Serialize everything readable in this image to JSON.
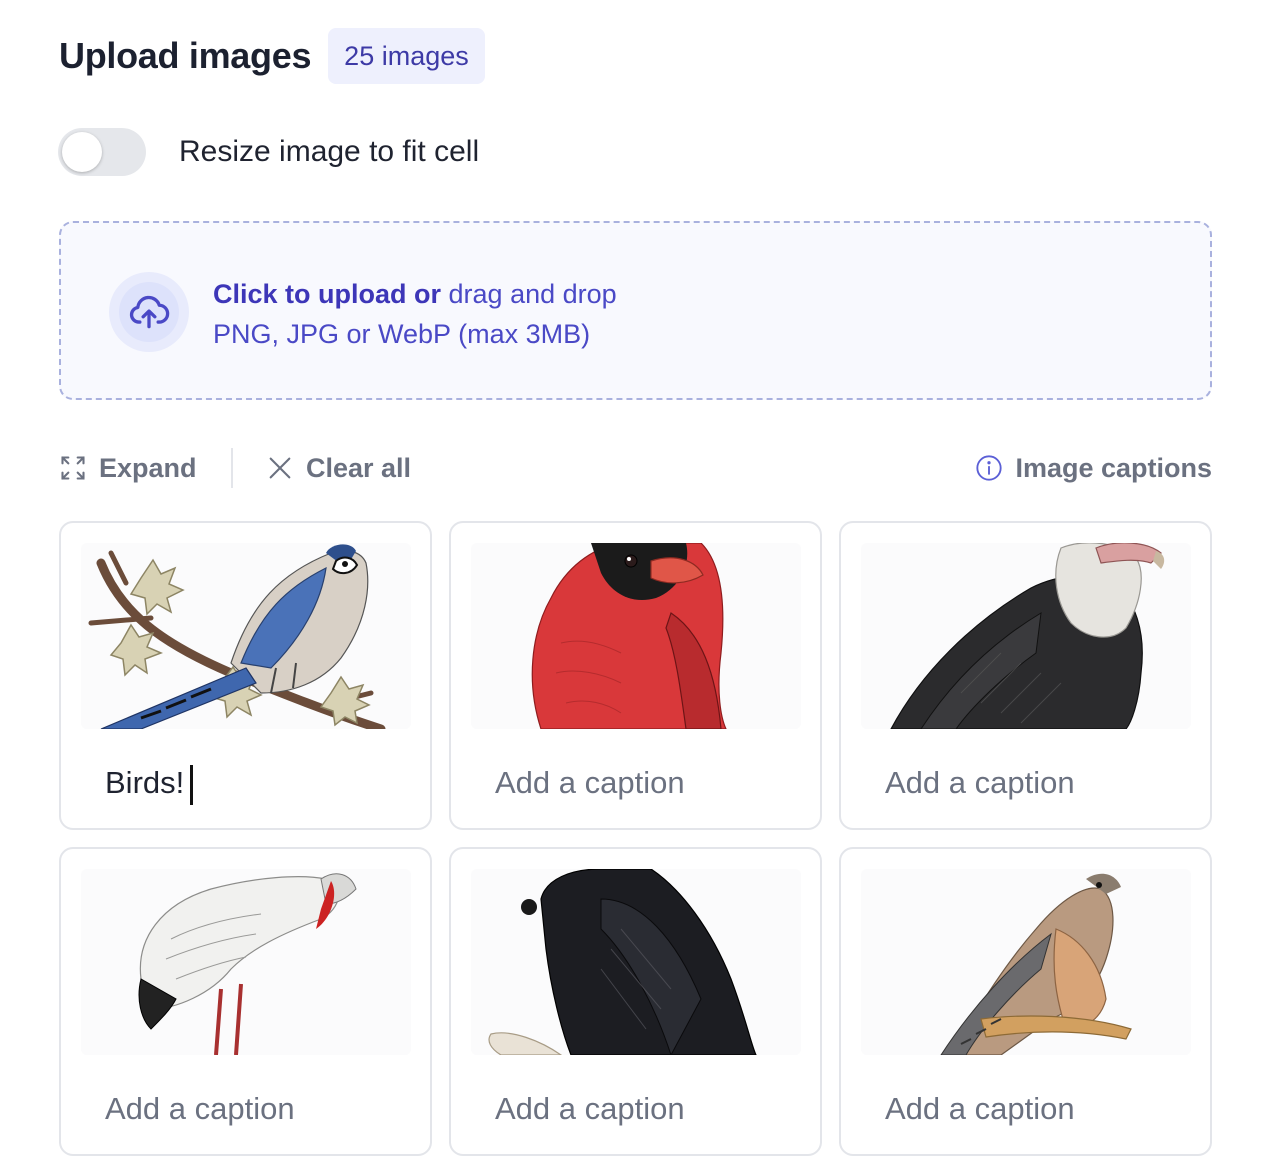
{
  "header": {
    "title": "Upload images",
    "badge": "25 images"
  },
  "resize_toggle": {
    "label": "Resize image to fit cell",
    "checked": false
  },
  "dropzone": {
    "click_text": "Click to upload or",
    "drag_text": "drag and drop",
    "formats": "PNG, JPG or WebP (max 3MB)",
    "icon": "upload-cloud-icon"
  },
  "toolbar": {
    "expand_label": "Expand",
    "clear_label": "Clear all",
    "captions_label": "Image captions"
  },
  "cards": [
    {
      "caption_value": "Birds!",
      "caption_placeholder": "Add a caption",
      "bird": "blue jay"
    },
    {
      "caption_value": "",
      "caption_placeholder": "Add a caption",
      "bird": "cardinal"
    },
    {
      "caption_value": "",
      "caption_placeholder": "Add a caption",
      "bird": "vulture"
    },
    {
      "caption_value": "",
      "caption_placeholder": "Add a caption",
      "bird": "crane"
    },
    {
      "caption_value": "",
      "caption_placeholder": "Add a caption",
      "bird": "raven"
    },
    {
      "caption_value": "",
      "caption_placeholder": "Add a caption",
      "bird": "kestrel"
    }
  ],
  "colors": {
    "accent": "#3d36b8",
    "badge_bg": "#eef0fd",
    "dropzone_border": "#a9b1de",
    "muted_text": "#6b7180"
  }
}
